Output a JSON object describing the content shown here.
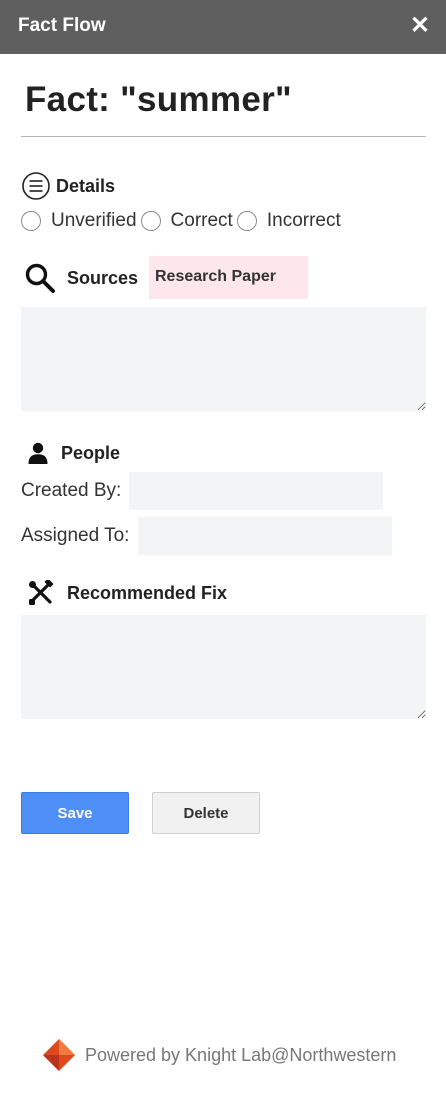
{
  "window": {
    "title": "Fact Flow",
    "close_glyph": "✕"
  },
  "fact": {
    "heading": "Fact: \"summer\""
  },
  "details": {
    "label": "Details",
    "icon": "menu-circle-icon",
    "options": [
      "Unverified",
      "Correct",
      "Incorrect"
    ]
  },
  "sources": {
    "label": "Sources",
    "icon": "search-icon",
    "tag": "Research Paper",
    "value": ""
  },
  "people": {
    "label": "People",
    "icon": "person-icon",
    "created_by_label": "Created By:",
    "created_by_value": "",
    "assigned_to_label": "Assigned To:",
    "assigned_to_value": ""
  },
  "recommended_fix": {
    "label": "Recommended Fix",
    "icon": "tools-icon",
    "value": ""
  },
  "actions": {
    "save": "Save",
    "delete": "Delete"
  },
  "footer": {
    "text": "Powered by Knight Lab@Northwestern",
    "logo": "knight-lab-logo"
  },
  "colors": {
    "titlebar": "#5f5f5f",
    "save": "#4d8ef7",
    "tag": "#fde7ec",
    "field": "#f3f4f5",
    "logo": "#e0481e"
  }
}
